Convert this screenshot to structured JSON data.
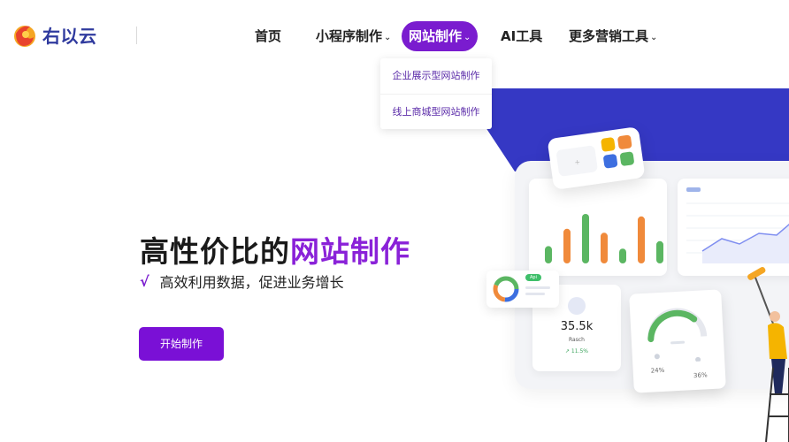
{
  "brand": {
    "name": "右以云"
  },
  "nav": {
    "home": "首页",
    "mini_program": "小程序制作",
    "website": "网站制作",
    "ai_tools": "AI工具",
    "more_marketing": "更多营销工具"
  },
  "dropdown": {
    "items": [
      "企业展示型网站制作",
      "线上商城型网站制作"
    ]
  },
  "hero": {
    "title_prefix": "高性价比的",
    "title_accent": "网站制作",
    "check": "√",
    "subtitle": "高效利用数据，促进业务增长",
    "cta": "开始制作"
  },
  "illustration": {
    "stat_value": "35.5k",
    "stat_label": "Rasch",
    "stat_change": "↗ 11.5%",
    "gauge_left": "24%",
    "gauge_right": "36%",
    "tag": "Api",
    "bar_heights": [
      0.35,
      0.7,
      1.0,
      0.62,
      0.3,
      0.95,
      0.45
    ],
    "bar_colors": [
      "#5bb662",
      "#f08a3b",
      "#5bb662",
      "#f08a3b",
      "#5bb662",
      "#f08a3b",
      "#5bb662"
    ]
  },
  "colors": {
    "accent": "#7a1ccf",
    "brand_blue": "#2f3a9e",
    "illustration_blue": "#3538c4"
  }
}
